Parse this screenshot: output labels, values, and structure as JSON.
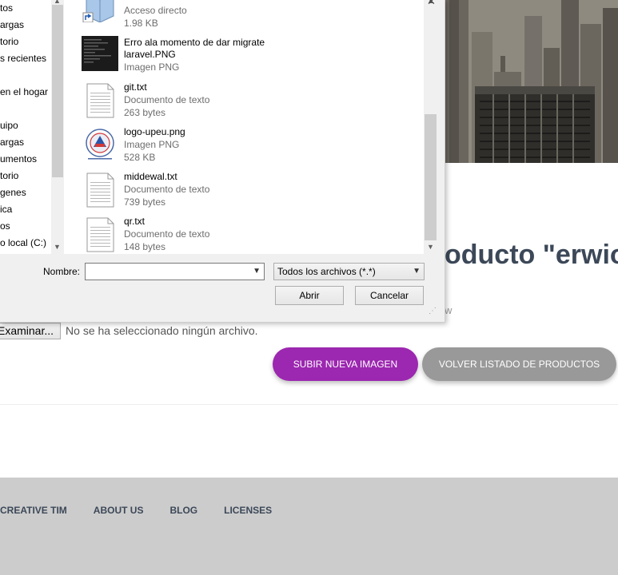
{
  "dialog": {
    "nav_items": [
      "tos",
      "argas",
      "torio",
      "s recientes",
      "en el hogar",
      "uipo",
      "argas",
      "umentos",
      "torio",
      "genes",
      "ica",
      "os",
      "o local (C:)"
    ],
    "files": [
      {
        "name": "",
        "type": "Acceso directo",
        "size": "1.98 KB",
        "icon": "shortcut-icon"
      },
      {
        "name": "Erro ala momento de dar migrate laravel.PNG",
        "name_line1": "Erro ala momento de dar migrate",
        "name_line2": "laravel.PNG",
        "type": "Imagen PNG",
        "size": "",
        "icon": "image-thumbnail"
      },
      {
        "name": "git.txt",
        "type": "Documento de texto",
        "size": "263 bytes",
        "icon": "text-file-icon"
      },
      {
        "name": "logo-upeu.png",
        "type": "Imagen PNG",
        "size": "528 KB",
        "icon": "logo-thumbnail"
      },
      {
        "name": "middewal.txt",
        "type": "Documento de texto",
        "size": "739 bytes",
        "icon": "text-file-icon"
      },
      {
        "name": "qr.txt",
        "type": "Documento de texto",
        "size": "148 bytes",
        "icon": "text-file-icon"
      }
    ],
    "nombre_label": "Nombre:",
    "nombre_value": "",
    "filter_value": "Todos los archivos (*.*)",
    "open_label": "Abrir",
    "cancel_label": "Cancelar"
  },
  "page": {
    "title_fragment": "oducto \"erwion",
    "subtitle_fragment": "w",
    "browse_label": "Examinar...",
    "file_status": "No se ha seleccionado ningún archivo.",
    "upload_button": "SUBIR NUEVA IMAGEN",
    "back_button": "VOLVER LISTADO DE PRODUCTOS"
  },
  "footer": {
    "links": [
      "CREATIVE TIM",
      "ABOUT US",
      "BLOG",
      "LICENSES"
    ]
  },
  "colors": {
    "primary": "#9c27b0",
    "secondary": "#999999",
    "footer_bg": "#cccccc",
    "title": "#3c4858"
  }
}
